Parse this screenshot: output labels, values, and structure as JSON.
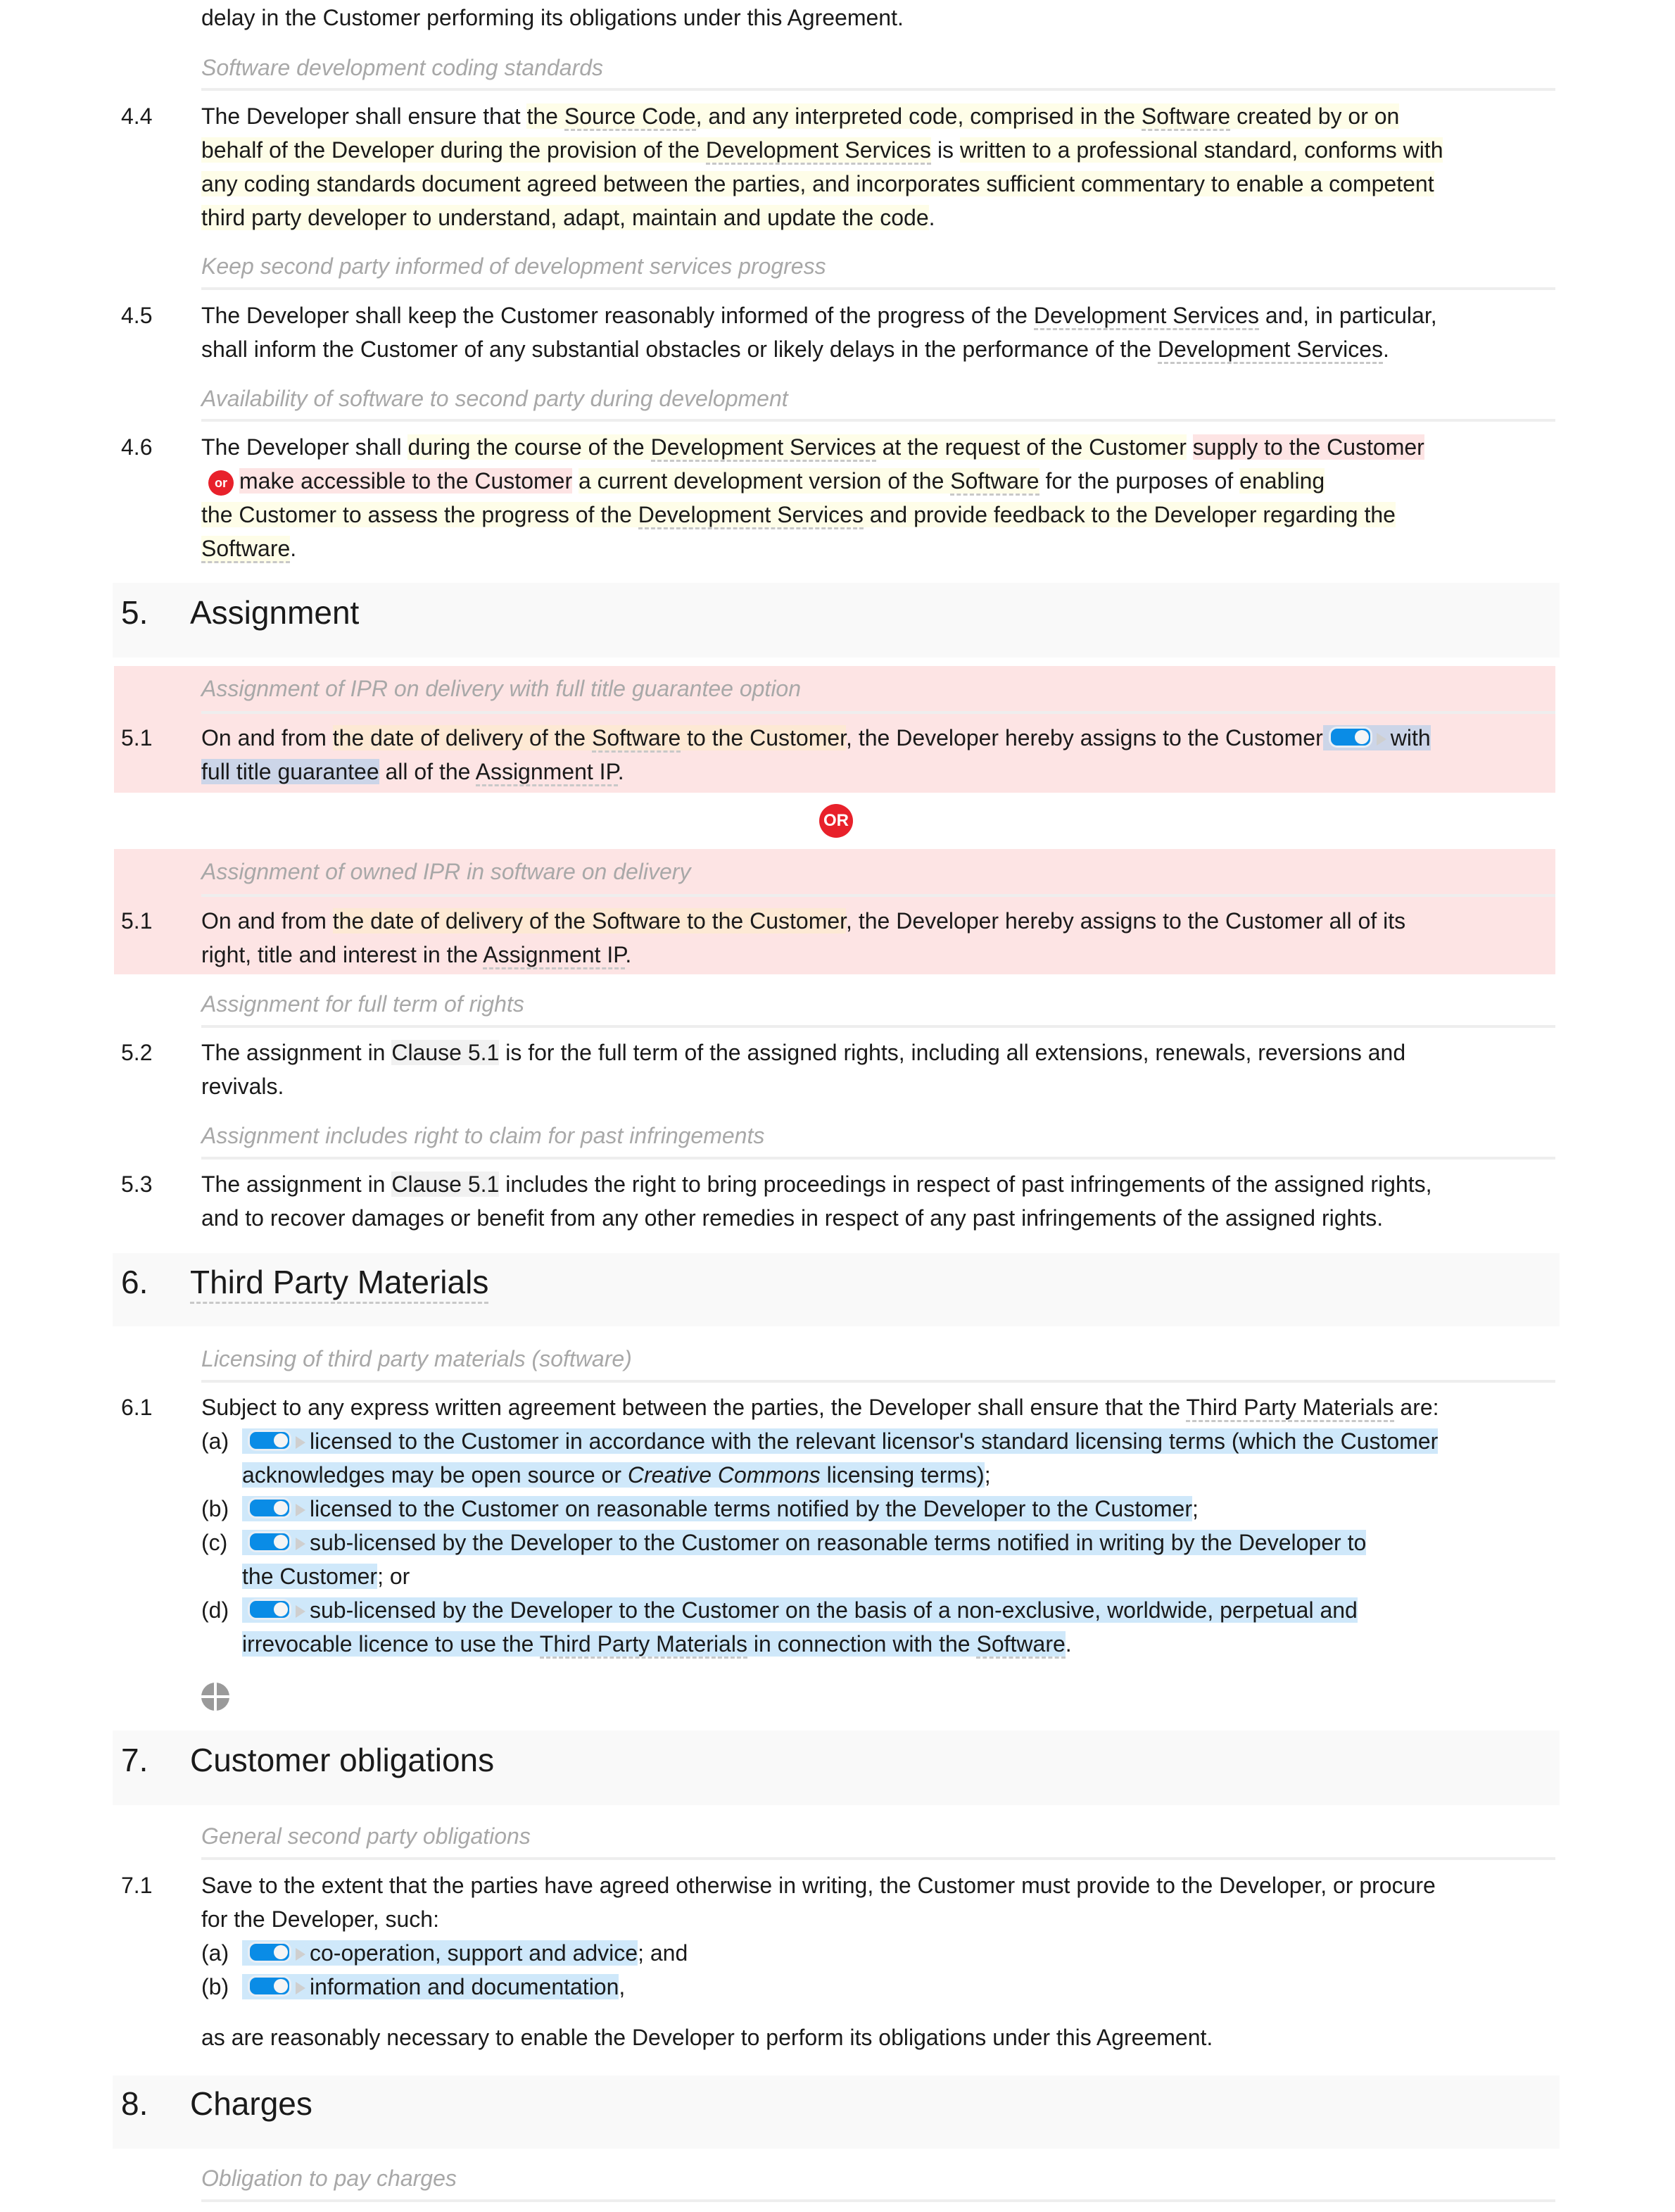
{
  "colors": {
    "highlight_yellow": "#fefde8",
    "highlight_red": "#fde4e4",
    "highlight_orange": "#fde9d4",
    "highlight_blue": "#cfe8fa",
    "toggle_blue": "#0a8ce6",
    "or_badge_red": "#e8212b",
    "caption_gray": "#a8a8a8"
  },
  "intro_line": "delay in the Customer performing its obligations under this Agreement.",
  "s4": {
    "c44": {
      "caption": "Software development coding standards",
      "num": "4.4",
      "l1a": "The Developer shall ensure that ",
      "l1b": "the ",
      "l1c": "Source Code",
      "l1d": ", and any interpreted code, comprised in the ",
      "l1e": "Software",
      "l1f": " created by or on",
      "l2a": "behalf of the Developer during the provision of the ",
      "l2b": "Development Services",
      "l2c": " is ",
      "l2d": "written to a professional standard, conforms with",
      "l3": "any coding standards document agreed between the parties, and incorporates sufficient commentary to enable a competent",
      "l4": "third party developer to understand, adapt, maintain and update the code",
      "l4end": "."
    },
    "c45": {
      "caption": "Keep second party informed of development services progress",
      "num": "4.5",
      "l1a": "The Developer shall keep the Customer reasonably informed of the progress of the ",
      "l1b": "Development Services",
      "l1c": " and, in particular,",
      "l2a": "shall inform the Customer of any substantial obstacles or likely delays in the performance of the ",
      "l2b": "Development Services",
      "l2c": "."
    },
    "c46": {
      "caption": "Availability of software to second party during development",
      "num": "4.6",
      "l1a": "The Developer shall ",
      "l1b": "during the course of the ",
      "l1c": "Development Services",
      "l1d": " at the request of the Customer",
      "l1e": " ",
      "l1f": "supply to the Customer",
      "or_label": "or",
      "l2a": "make accessible to the Customer",
      "l2b": " ",
      "l2c": "a current development version of the ",
      "l2d": "Software",
      "l2e": " for the purposes of ",
      "l2f": "enabling",
      "l3a": "the Customer to assess the progress of the ",
      "l3b": "Development Services",
      "l3c": " and provide feedback to the Developer regarding the",
      "l4a": "Software",
      "l4b": "."
    }
  },
  "s5": {
    "num": "5.",
    "title": "Assignment",
    "optA": {
      "caption": "Assignment of IPR on delivery with full title guarantee option",
      "num": "5.1",
      "l1a": "On and from ",
      "l1b": "the date of delivery of the ",
      "l1c": "Software",
      "l1d": " to the Customer",
      "l1e": ", the Developer hereby assigns to the Customer",
      "l1f": "with",
      "toggle_on": true,
      "l2a": "full title guarantee",
      "l2b": " all of the ",
      "l2c": "Assignment IP",
      "l2d": "."
    },
    "or_label": "OR",
    "optB": {
      "caption": "Assignment of owned IPR in software on delivery",
      "num": "5.1",
      "l1a": "On and from ",
      "l1b": "the date of delivery of the Software to the Customer",
      "l1c": ", the Developer hereby assigns to the Customer all of its",
      "l2a": "right, title and interest in the ",
      "l2b": "Assignment IP",
      "l2c": "."
    },
    "c52": {
      "caption": "Assignment for full term of rights",
      "num": "5.2",
      "l1a": "The assignment in ",
      "l1b": "Clause 5.1",
      "l1c": " is for the full term of the assigned rights, including all extensions, renewals, reversions and",
      "l2": "revivals."
    },
    "c53": {
      "caption": "Assignment includes right to claim for past infringements",
      "num": "5.3",
      "l1a": "The assignment in ",
      "l1b": "Clause 5.1",
      "l1c": " includes the right to bring proceedings in respect of past infringements of the assigned rights,",
      "l2": "and to recover damages or benefit from any other remedies in respect of any past infringements of the assigned rights."
    }
  },
  "s6": {
    "num": "6.",
    "title": "Third Party Materials",
    "c61": {
      "caption": "Licensing of third party materials (software)",
      "num": "6.1",
      "l1a": "Subject to any express written agreement between the parties, the Developer shall ensure that the ",
      "l1b": "Third Party Materials",
      "l1c": " are:",
      "items": [
        {
          "label": "(a)",
          "toggle_on": true,
          "l1": "licensed to the Customer in accordance with the relevant licensor's standard licensing terms (which the Customer",
          "l2a": "acknowledges may be open source or ",
          "l2b": "Creative Commons",
          "l2c": " licensing terms)",
          "l2d": ";"
        },
        {
          "label": "(b)",
          "toggle_on": true,
          "l1": "licensed to the Customer on reasonable terms notified by the Developer to the Customer",
          "l1end": ";"
        },
        {
          "label": "(c)",
          "toggle_on": true,
          "l1": "sub-licensed by the Developer to the Customer on reasonable terms notified in writing by the Developer to",
          "l2a": "the Customer",
          "l2b": "; or"
        },
        {
          "label": "(d)",
          "toggle_on": true,
          "l1": "sub-licensed by the Developer to the Customer on the basis of a non-exclusive, worldwide, perpetual and",
          "l2a": "irrevocable licence to use the ",
          "l2b": "Third Party Materials",
          "l2c": " in connection with the ",
          "l2d": "Software",
          "l2e": "."
        }
      ]
    },
    "add_icon": "drag-move-icon"
  },
  "s7": {
    "num": "7.",
    "title": "Customer obligations",
    "c71": {
      "caption": "General second party obligations",
      "num": "7.1",
      "l1": "Save to the extent that the parties have agreed otherwise in writing, the Customer must provide to the Developer, or procure",
      "l2": "for the Developer, such:",
      "items": [
        {
          "label": "(a)",
          "toggle_on": true,
          "text": "co-operation, support and advice",
          "after": "; and"
        },
        {
          "label": "(b)",
          "toggle_on": true,
          "text": "information and documentation",
          "after": ","
        }
      ],
      "closing": "as are reasonably necessary to enable the Developer to perform its obligations under this Agreement."
    }
  },
  "s8": {
    "num": "8.",
    "title": "Charges",
    "caption": "Obligation to pay charges"
  }
}
